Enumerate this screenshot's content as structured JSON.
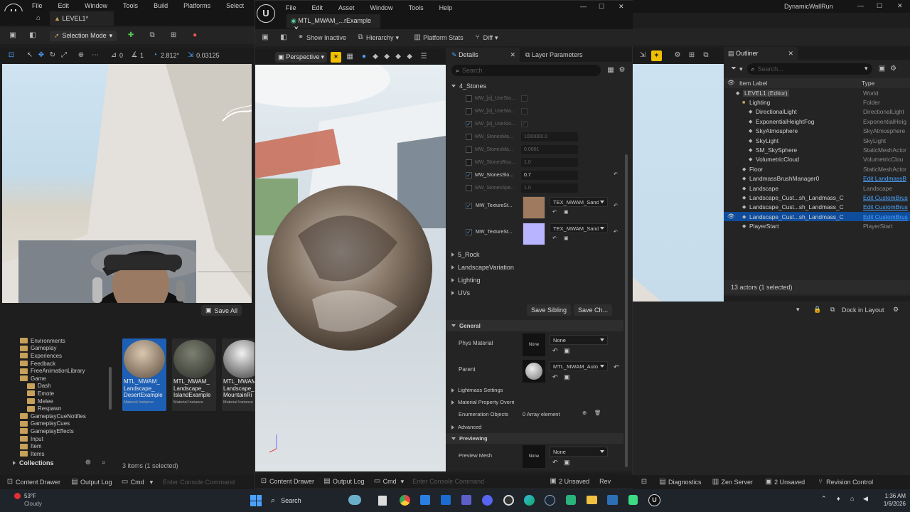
{
  "main_editor": {
    "menu": [
      "File",
      "Edit",
      "Window",
      "Tools",
      "Build",
      "Platforms",
      "Select",
      "Actor"
    ],
    "level_tab": "LEVEL1*",
    "selection_mode": "Selection Mode",
    "snap_angle": "2.812°",
    "snap_scale": "0.03125",
    "save_all": "Save All",
    "collections": "Collections",
    "items_count": "3 items (1 selected)",
    "folders": [
      {
        "label": "Environments",
        "indent": 1
      },
      {
        "label": "Gameplay",
        "indent": 1
      },
      {
        "label": "Experiences",
        "indent": 1
      },
      {
        "label": "Feedback",
        "indent": 1
      },
      {
        "label": "FreeAnimationLibrary",
        "indent": 1
      },
      {
        "label": "Game",
        "indent": 1
      },
      {
        "label": "Dash",
        "indent": 2
      },
      {
        "label": "Emote",
        "indent": 2
      },
      {
        "label": "Melee",
        "indent": 2
      },
      {
        "label": "Respawn",
        "indent": 2
      },
      {
        "label": "GameplayCueNotifies",
        "indent": 1
      },
      {
        "label": "GameplayCues",
        "indent": 1
      },
      {
        "label": "GameplayEffects",
        "indent": 1
      },
      {
        "label": "Input",
        "indent": 1
      },
      {
        "label": "Item",
        "indent": 1
      },
      {
        "label": "Items",
        "indent": 1
      }
    ],
    "assets": [
      {
        "line1": "MTL_MWAM_",
        "line2": "Landscape_",
        "line3": "DesertExample",
        "sub": "Material Instance",
        "selected": true
      },
      {
        "line1": "MTL_MWAM_",
        "line2": "Landscape_",
        "line3": "IslandExample",
        "sub": "Material Instance",
        "selected": false
      },
      {
        "line1": "MTL_MWAM_",
        "line2": "Landscape_",
        "line3": "MountainRi",
        "sub": "Material Instance",
        "selected": false
      }
    ],
    "bottom_bar": {
      "content_drawer": "Content Drawer",
      "output_log": "Output Log",
      "cmd": "Cmd",
      "console_placeholder": "Enter Console Command"
    }
  },
  "material_editor": {
    "menu": [
      "File",
      "Edit",
      "Asset",
      "Window",
      "Tools",
      "Help"
    ],
    "tab_title": "MTL_MWAM_...rExample",
    "toolbar": {
      "show_inactive": "Show Inactive",
      "hierarchy": "Hierarchy",
      "platform_stats": "Platform Stats",
      "diff": "Diff"
    },
    "viewport_mode": "Perspective",
    "details_tab": "Details",
    "layer_params_tab": "Layer Parameters",
    "search_placeholder": "Search",
    "group_stones": "4_Stones",
    "stone_props": [
      {
        "name": "MW_[a]_UseSto...",
        "value": "",
        "checked": false,
        "enabled": false,
        "kind": "check"
      },
      {
        "name": "MW_[a]_UseSto...",
        "value": "",
        "checked": false,
        "enabled": false,
        "kind": "check"
      },
      {
        "name": "MW_[a]_UseSto...",
        "value": "",
        "checked": true,
        "enabled": false,
        "kind": "check"
      },
      {
        "name": "MW_StonesMa...",
        "value": "1000000.0",
        "checked": false,
        "enabled": false,
        "kind": "num"
      },
      {
        "name": "MW_StonesMa...",
        "value": "0.0001",
        "checked": false,
        "enabled": false,
        "kind": "num"
      },
      {
        "name": "MW_StonesRou...",
        "value": "1.0",
        "checked": false,
        "enabled": false,
        "kind": "num"
      },
      {
        "name": "MW_StonesSlo...",
        "value": "0.7",
        "checked": true,
        "enabled": true,
        "kind": "num"
      },
      {
        "name": "MW_StonesSpe...",
        "value": "1.0",
        "checked": false,
        "enabled": false,
        "kind": "num"
      }
    ],
    "texture_props": [
      {
        "name": "MW_TextureSt...",
        "value": "TEX_MWAM_Sand",
        "swatch": "#a07a5e"
      },
      {
        "name": "MW_TextureSt...",
        "value": "TEX_MWAM_Sand",
        "swatch": "#b8b4ff"
      }
    ],
    "groups_collapsed": [
      "5_Rock",
      "LandscapeVariation",
      "Lighting",
      "UVs"
    ],
    "save_sibling": "Save Sibling",
    "save_child": "Save Ch...",
    "general": {
      "title": "General",
      "phys_material_label": "Phys Material",
      "phys_material_value": "None",
      "phys_thumb": "None",
      "parent_label": "Parent",
      "parent_value": "MTL_MWAM_Auto",
      "lightmass": "Lightmass Settings",
      "material_property_override": "Material Property Overri",
      "enum_objects_label": "Enumeration Objects",
      "enum_objects_value": "0 Array element",
      "advanced": "Advanced"
    },
    "previewing": {
      "title": "Previewing",
      "preview_mesh_label": "Preview Mesh",
      "preview_mesh_value": "None",
      "preview_thumb": "None"
    },
    "bottom_bar": {
      "content_drawer": "Content Drawer",
      "output_log": "Output Log",
      "cmd": "Cmd",
      "console_placeholder": "Enter Console Command",
      "unsaved": "2 Unsaved",
      "rev": "Rev"
    }
  },
  "outliner": {
    "window_title": "DynamicWallRun",
    "tab": "Outliner",
    "search_placeholder": "Search...",
    "col_label": "Item Label",
    "col_type": "Type",
    "rows": [
      {
        "label": "LEVEL1 (Editor)",
        "type": "World",
        "indent": 1,
        "link": false,
        "highlight": true
      },
      {
        "label": "Lighting",
        "type": "Folder",
        "indent": 2,
        "link": false
      },
      {
        "label": "DirectionalLight",
        "type": "DirectionalLight",
        "indent": 3,
        "link": false
      },
      {
        "label": "ExponentialHeightFog",
        "type": "ExponentialHeig",
        "indent": 3,
        "link": false
      },
      {
        "label": "SkyAtmosphere",
        "type": "SkyAtmosphere",
        "indent": 3,
        "link": false
      },
      {
        "label": "SkyLight",
        "type": "SkyLight",
        "indent": 3,
        "link": false
      },
      {
        "label": "SM_SkySphere",
        "type": "StaticMeshActor",
        "indent": 3,
        "link": false
      },
      {
        "label": "VolumetricCloud",
        "type": "VolumetricClou",
        "indent": 3,
        "link": false
      },
      {
        "label": "Floor",
        "type": "StaticMeshActor",
        "indent": 2,
        "link": false
      },
      {
        "label": "LandmassBrushManager0",
        "type": "Edit LandmassB",
        "indent": 2,
        "link": true
      },
      {
        "label": "Landscape",
        "type": "Landscape",
        "indent": 2,
        "link": false
      },
      {
        "label": "Landscape_Cust...sh_Landmass_C",
        "type": "Edit CustomBrus",
        "indent": 2,
        "link": true
      },
      {
        "label": "Landscape_Cust...sh_Landmass_C",
        "type": "Edit CustomBrus",
        "indent": 2,
        "link": true
      },
      {
        "label": "Landscape_Cust...sh_Landmass_C",
        "type": "Edit CustomBrus",
        "indent": 2,
        "link": true,
        "selected": true
      },
      {
        "label": "PlayerStart",
        "type": "PlayerStart",
        "indent": 2,
        "link": false
      }
    ],
    "actors_status": "13 actors (1 selected)",
    "dock_in_layout": "Dock in Layout",
    "bottom_bar": {
      "diagnostics": "Diagnostics",
      "zen_server": "Zen Server",
      "unsaved": "2 Unsaved",
      "revision_control": "Revision Control"
    }
  },
  "taskbar": {
    "weather_temp": "53°F",
    "weather_desc": "Cloudy",
    "search": "Search",
    "time": "1:36 AM",
    "date": "1/6/2026"
  }
}
